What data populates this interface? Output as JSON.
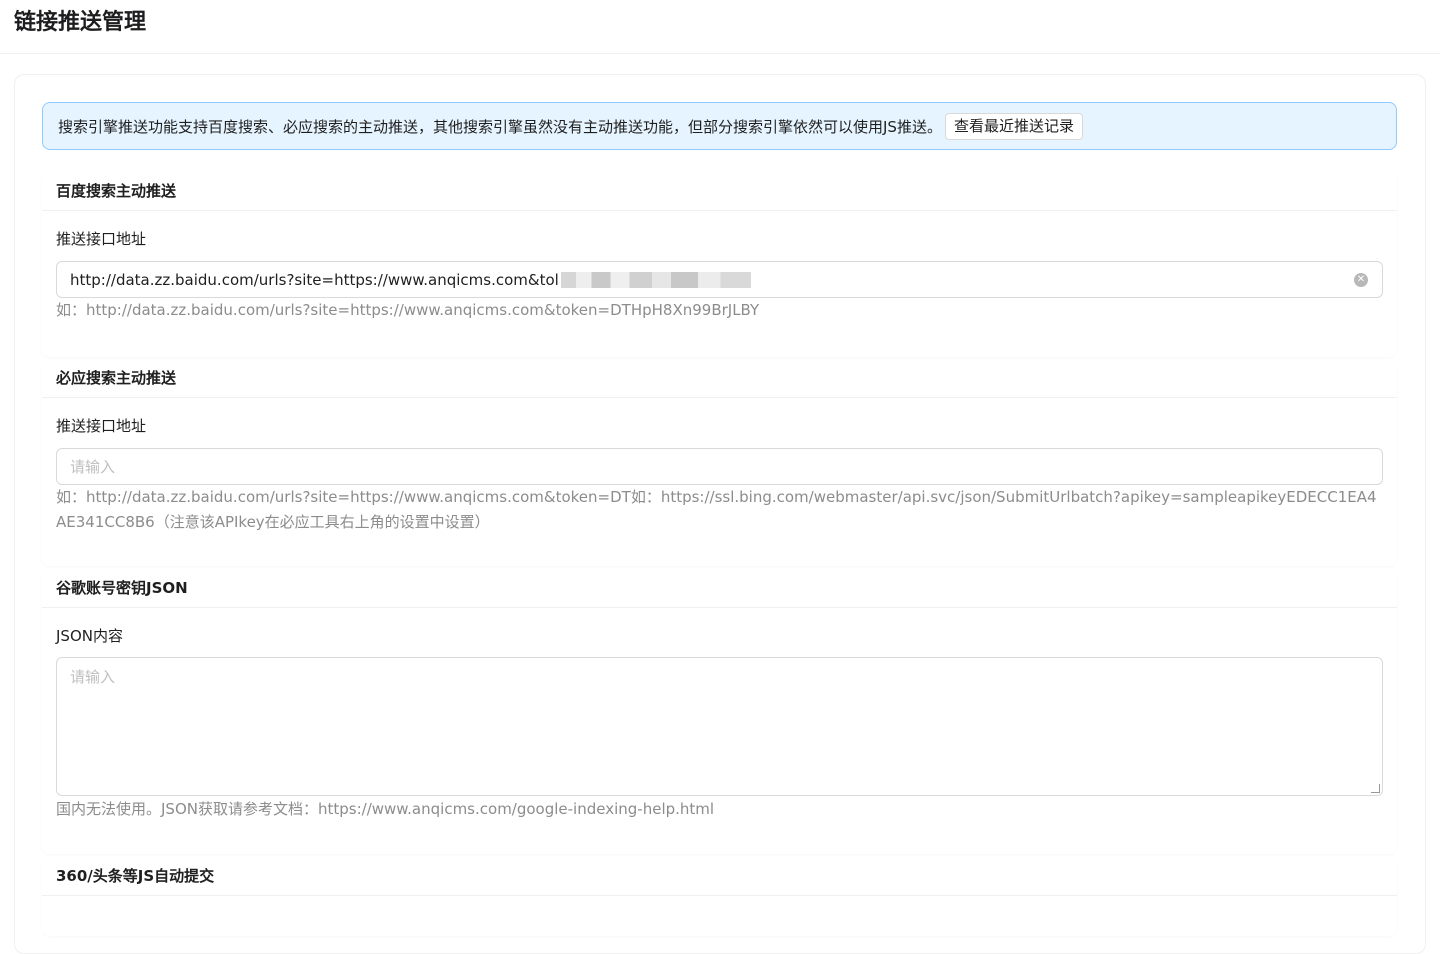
{
  "page": {
    "title": "链接推送管理"
  },
  "alert": {
    "text": "搜索引擎推送功能支持百度搜索、必应搜索的主动推送，其他搜索引擎虽然没有主动推送功能，但部分搜索引擎依然可以使用JS推送。",
    "button_label": "查看最近推送记录"
  },
  "baidu": {
    "title": "百度搜索主动推送",
    "field_label": "推送接口地址",
    "value": "http://data.zz.baidu.com/urls?site=https://www.anqicms.com&tol",
    "help": "如：http://data.zz.baidu.com/urls?site=https://www.anqicms.com&token=DTHpH8Xn99BrJLBY"
  },
  "bing": {
    "title": "必应搜索主动推送",
    "field_label": "推送接口地址",
    "placeholder": "请输入",
    "help": "如：http://data.zz.baidu.com/urls?site=https://www.anqicms.com&token=DT如：https://ssl.bing.com/webmaster/api.svc/json/SubmitUrlbatch?apikey=sampleapikeyEDECC1EA4AE341CC8B6（注意该APIkey在必应工具右上角的设置中设置）"
  },
  "google": {
    "title": "谷歌账号密钥JSON",
    "field_label": "JSON内容",
    "placeholder": "请输入",
    "help": "国内无法使用。JSON获取请参考文档：https://www.anqicms.com/google-indexing-help.html"
  },
  "js_push": {
    "title": "360/头条等JS自动提交"
  }
}
